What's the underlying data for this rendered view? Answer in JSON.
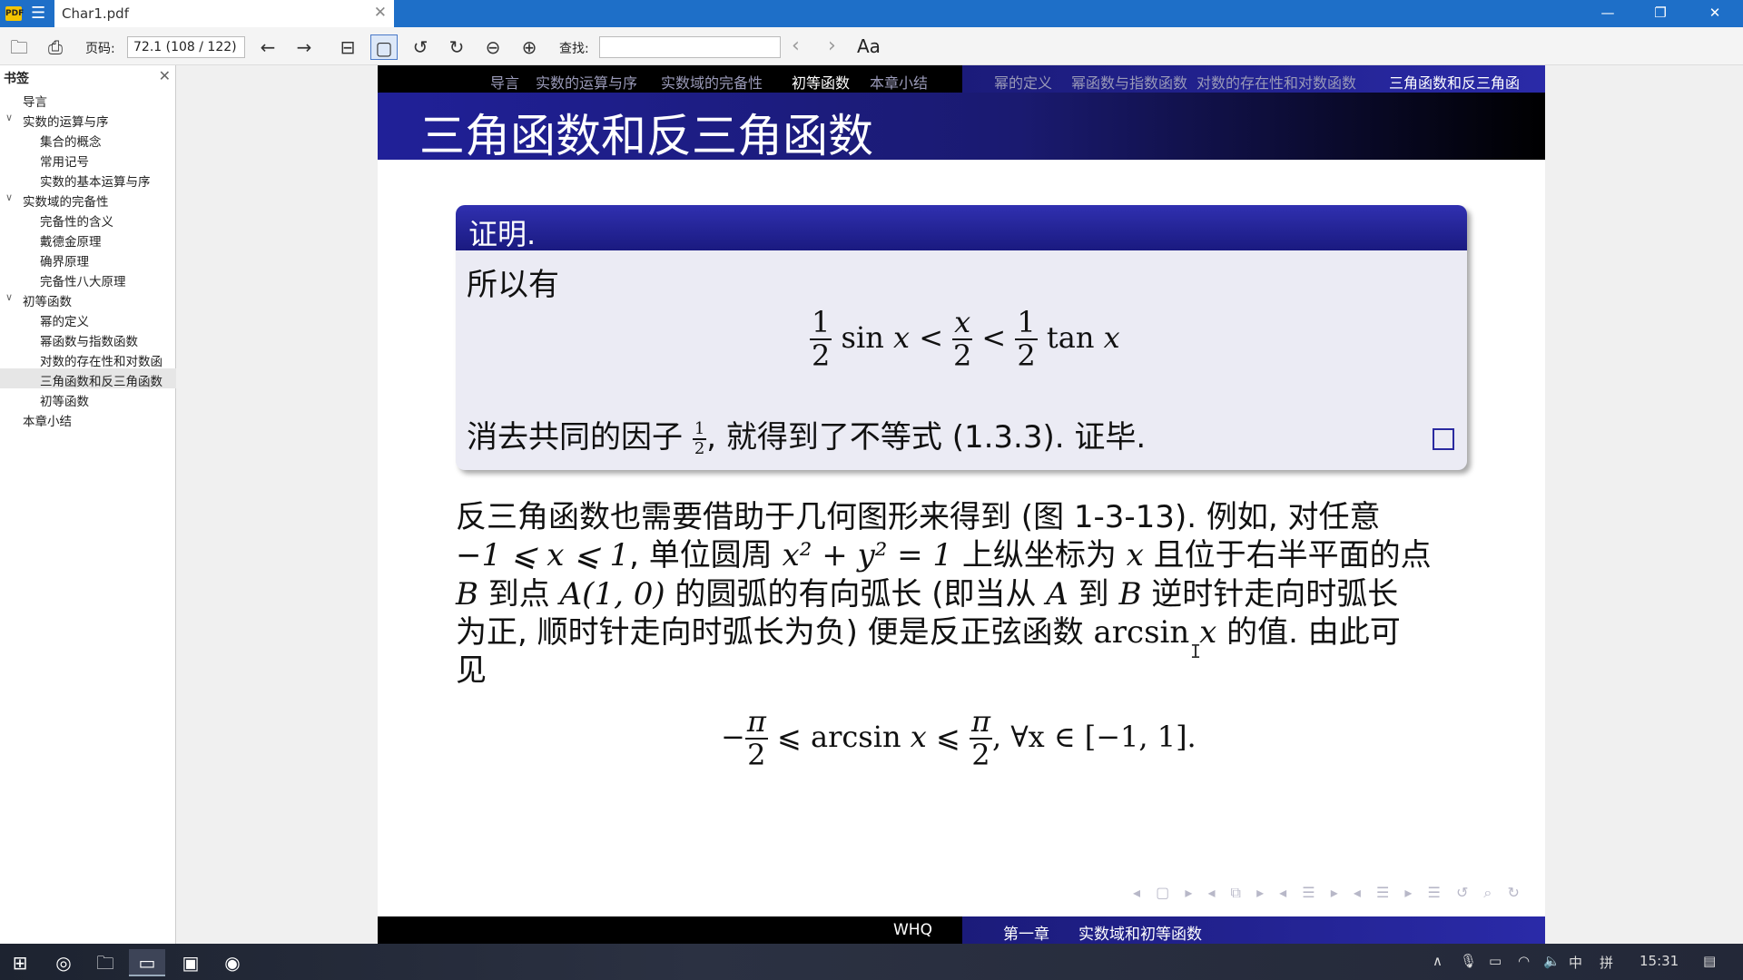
{
  "window": {
    "app_badge": "PDF",
    "tab_title": "Char1.pdf"
  },
  "toolbar": {
    "page_label": "页码:",
    "page_value": "72.1 (108 / 122)",
    "search_label": "查找:",
    "search_value": "",
    "font_button": "Aa"
  },
  "sidebar": {
    "title": "书签",
    "items": [
      {
        "label": "导言",
        "level": 0,
        "twisty": ""
      },
      {
        "label": "实数的运算与序",
        "level": 0,
        "twisty": "∨"
      },
      {
        "label": "集合的概念",
        "level": 1,
        "twisty": ""
      },
      {
        "label": "常用记号",
        "level": 1,
        "twisty": ""
      },
      {
        "label": "实数的基本运算与序",
        "level": 1,
        "twisty": ""
      },
      {
        "label": "实数域的完备性",
        "level": 0,
        "twisty": "∨"
      },
      {
        "label": "完备性的含义",
        "level": 1,
        "twisty": ""
      },
      {
        "label": "戴德金原理",
        "level": 1,
        "twisty": ""
      },
      {
        "label": "确界原理",
        "level": 1,
        "twisty": ""
      },
      {
        "label": "完备性八大原理",
        "level": 1,
        "twisty": ""
      },
      {
        "label": "初等函数",
        "level": 0,
        "twisty": "∨"
      },
      {
        "label": "幂的定义",
        "level": 1,
        "twisty": ""
      },
      {
        "label": "幂函数与指数函数",
        "level": 1,
        "twisty": ""
      },
      {
        "label": "对数的存在性和对数函",
        "level": 1,
        "twisty": ""
      },
      {
        "label": "三角函数和反三角函数",
        "level": 1,
        "twisty": "",
        "selected": true
      },
      {
        "label": "初等函数",
        "level": 1,
        "twisty": ""
      },
      {
        "label": "本章小结",
        "level": 0,
        "twisty": ""
      }
    ]
  },
  "slide": {
    "nav_sections": [
      "导言",
      "实数的运算与序",
      "实数域的完备性",
      "初等函数",
      "本章小结"
    ],
    "nav_subsections": [
      "幂的定义",
      "幂函数与指数函数",
      "对数的存在性和对数函数",
      "三角函数和反三角函"
    ],
    "frame_title": "三角函数和反三角函数",
    "proof": {
      "title": "证明.",
      "line1": "所以有",
      "eq1": {
        "half": "1",
        "two": "2",
        "sin": "sin",
        "x": "x",
        "lt": "<",
        "tan": "tan"
      },
      "line3_a": "消去共同的因子",
      "line3_b": ", 就得到了不等式 (1.3.3). 证毕."
    },
    "para": {
      "l1": "反三角函数也需要借助于几何图形来得到 (图 1-3-13). 例如, 对任意",
      "l2_a": "−1 ⩽ x ⩽ 1",
      "l2_b": ", 单位圆周 ",
      "l2_c": "x² + y² = 1",
      "l2_d": " 上纵坐标为 ",
      "l2_e": "x",
      "l2_f": " 且位于右半平面的点",
      "l3_a": "B",
      "l3_b": " 到点 ",
      "l3_c": "A(1, 0)",
      "l3_d": " 的圆弧的有向弧长 (即当从 ",
      "l3_e": "A",
      "l3_f": " 到 ",
      "l3_g": "B",
      "l3_h": " 逆时针走向时弧长",
      "l4_a": "为正, 顺时针走向时弧长为负) 便是反正弦函数 ",
      "l4_b": "arcsin",
      "l4_c": " x",
      "l4_d": " 的值. 由此可",
      "l5": "见"
    },
    "eq2": {
      "minus": "−",
      "pi": "π",
      "two": "2",
      "mid": " ⩽ arcsin ",
      "x": "x",
      "le": " ⩽ ",
      "tail": ",     ∀x ∈ [−1, 1]."
    },
    "footer_author": "WHQ",
    "footer_chapter": "第一章",
    "footer_title": "实数域和初等函数"
  },
  "taskbar": {
    "clock": "15:31",
    "ime_a": "中",
    "ime_b": "拼"
  },
  "colors": {
    "titlebar": "#1e6fc8",
    "beamer_blue": "#1b1b7a",
    "beamer_block_bg": "#ebebf4"
  }
}
